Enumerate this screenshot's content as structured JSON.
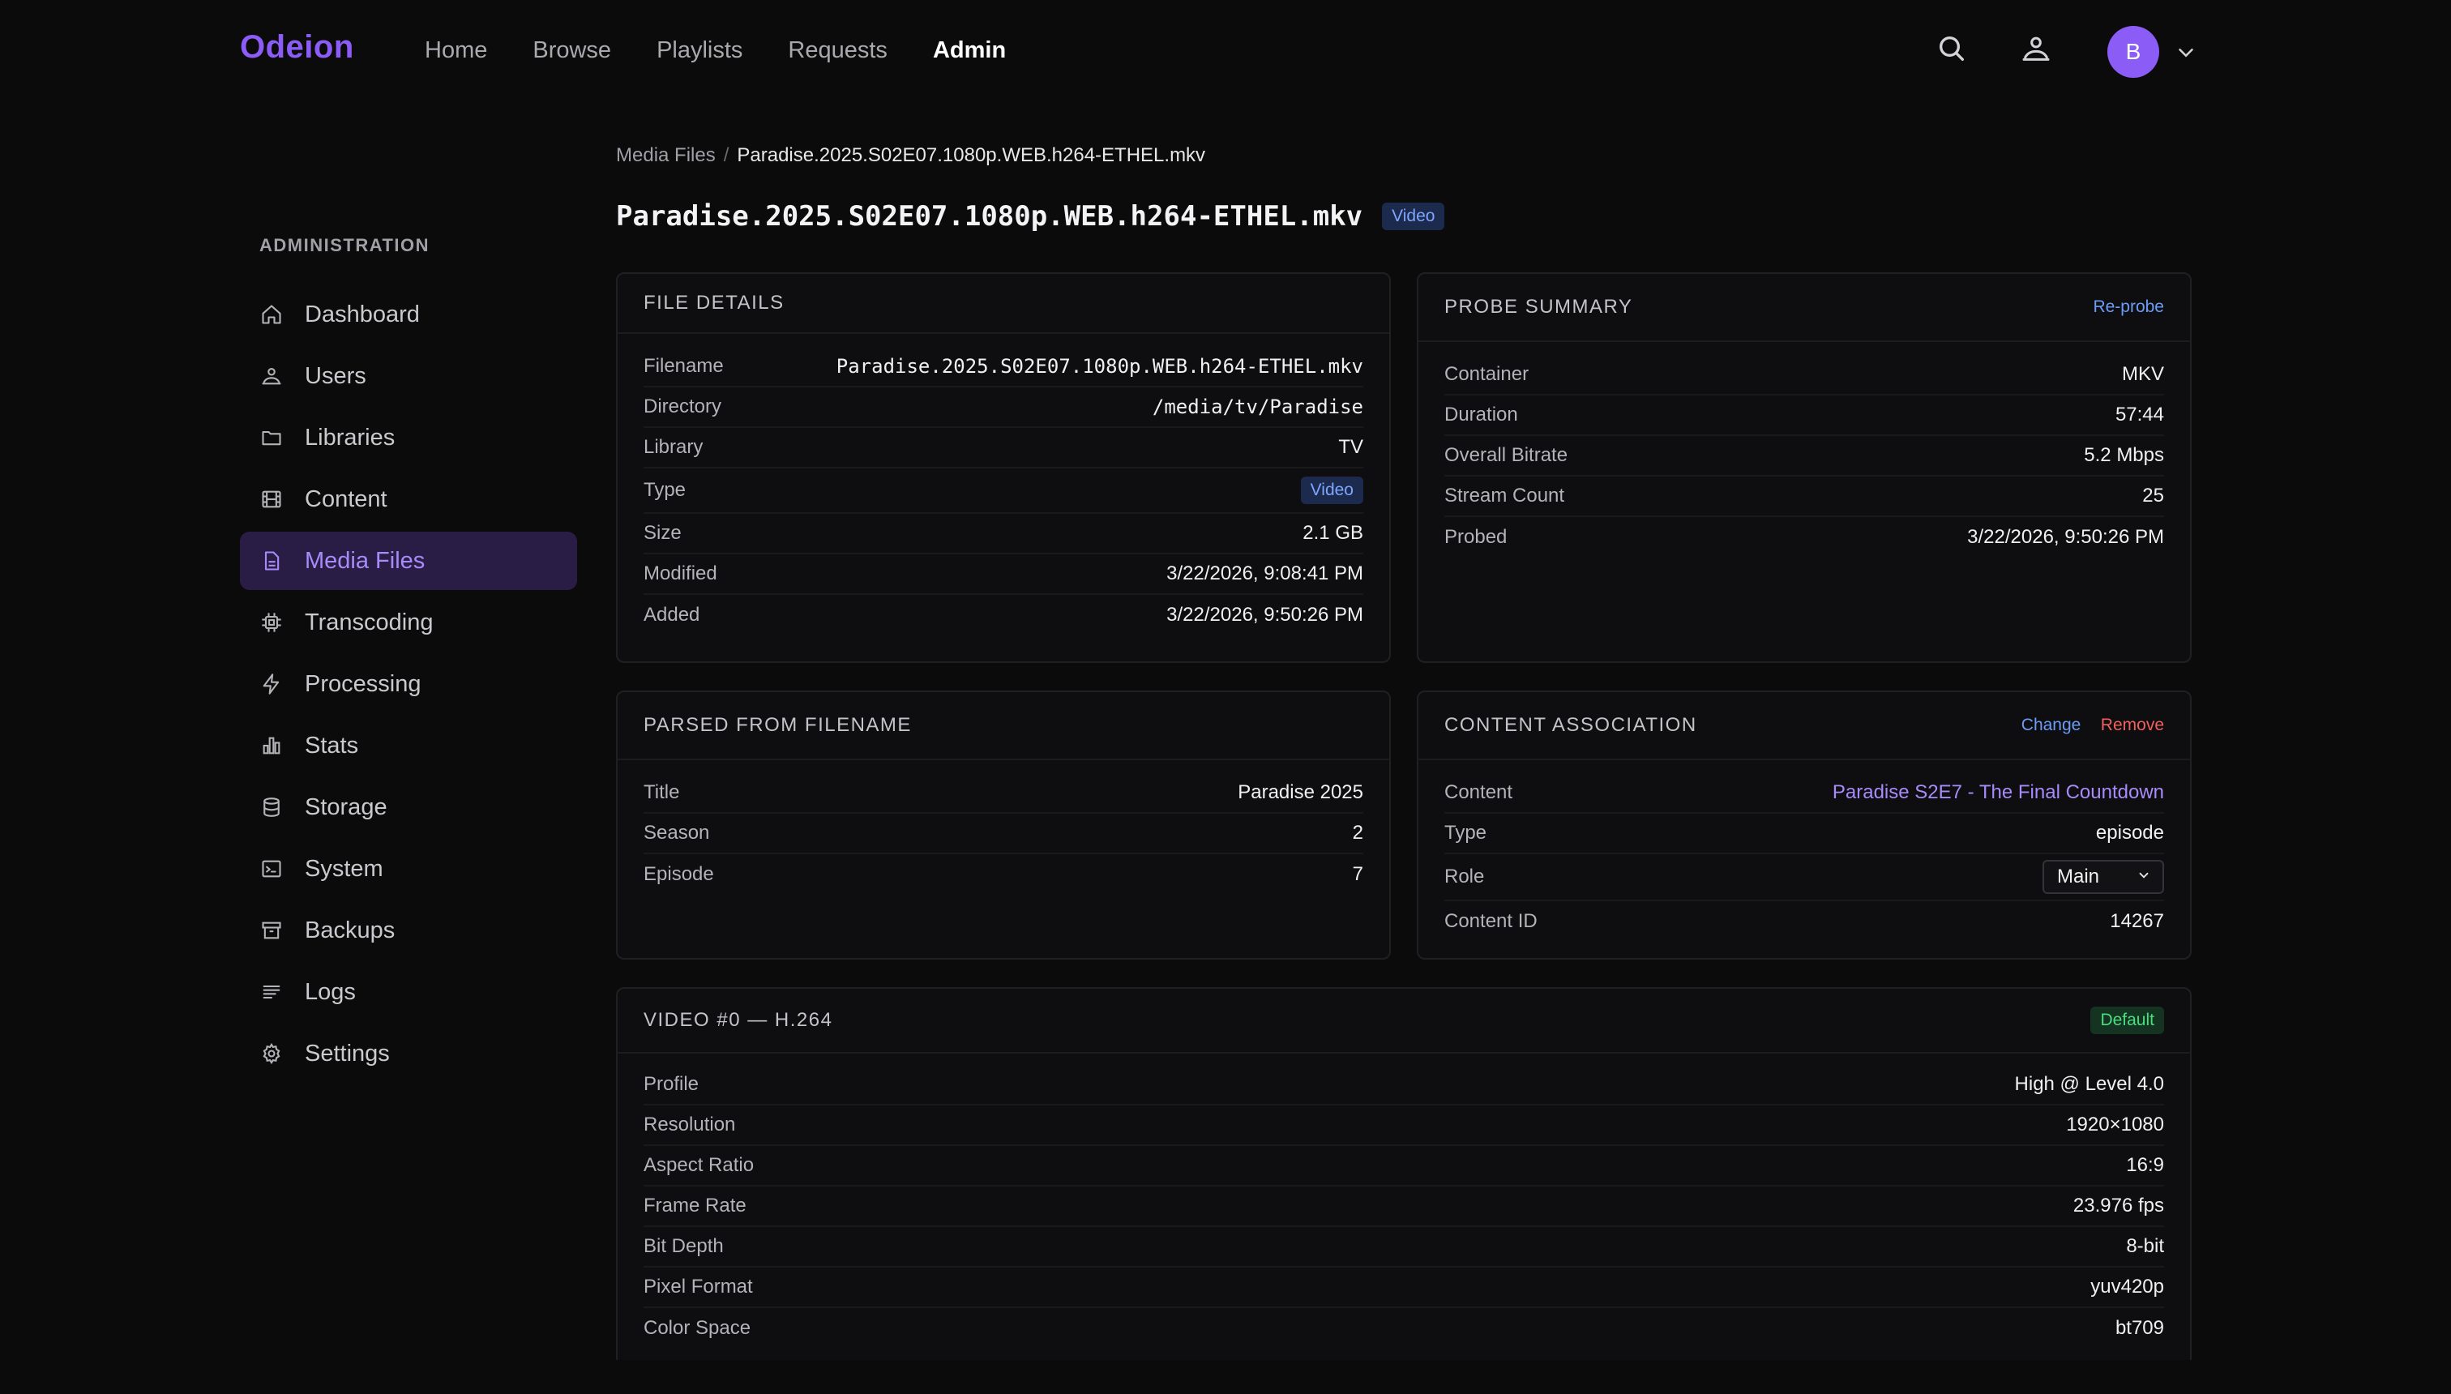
{
  "app": {
    "logo": "Odeion"
  },
  "nav": {
    "items": [
      {
        "label": "Home",
        "active": false
      },
      {
        "label": "Browse",
        "active": false
      },
      {
        "label": "Playlists",
        "active": false
      },
      {
        "label": "Requests",
        "active": false
      },
      {
        "label": "Admin",
        "active": true
      }
    ]
  },
  "user": {
    "initial": "B"
  },
  "sidebar": {
    "heading": "ADMINISTRATION",
    "items": [
      {
        "label": "Dashboard",
        "icon": "home-icon"
      },
      {
        "label": "Users",
        "icon": "users-icon"
      },
      {
        "label": "Libraries",
        "icon": "folder-icon"
      },
      {
        "label": "Content",
        "icon": "film-icon"
      },
      {
        "label": "Media Files",
        "icon": "file-icon",
        "active": true
      },
      {
        "label": "Transcoding",
        "icon": "chip-icon"
      },
      {
        "label": "Processing",
        "icon": "bolt-icon"
      },
      {
        "label": "Stats",
        "icon": "bar-chart-icon"
      },
      {
        "label": "Storage",
        "icon": "database-icon"
      },
      {
        "label": "System",
        "icon": "terminal-icon"
      },
      {
        "label": "Backups",
        "icon": "archive-icon"
      },
      {
        "label": "Logs",
        "icon": "list-icon"
      },
      {
        "label": "Settings",
        "icon": "gear-icon"
      }
    ]
  },
  "breadcrumb": {
    "root": "Media Files",
    "sep": "/",
    "current": "Paradise.2025.S02E07.1080p.WEB.h264-ETHEL.mkv"
  },
  "page": {
    "title": "Paradise.2025.S02E07.1080p.WEB.h264-ETHEL.mkv",
    "badge": "Video"
  },
  "file_details": {
    "title": "FILE DETAILS",
    "rows": [
      {
        "k": "Filename",
        "v": "Paradise.2025.S02E07.1080p.WEB.h264-ETHEL.mkv"
      },
      {
        "k": "Directory",
        "v": "/media/tv/Paradise"
      },
      {
        "k": "Library",
        "v": "TV"
      },
      {
        "k": "Type",
        "v": "Video"
      },
      {
        "k": "Size",
        "v": "2.1 GB"
      },
      {
        "k": "Modified",
        "v": "3/22/2026, 9:08:41 PM"
      },
      {
        "k": "Added",
        "v": "3/22/2026, 9:50:26 PM"
      }
    ]
  },
  "probe_summary": {
    "title": "PROBE SUMMARY",
    "action": "Re-probe",
    "rows": [
      {
        "k": "Container",
        "v": "MKV"
      },
      {
        "k": "Duration",
        "v": "57:44"
      },
      {
        "k": "Overall Bitrate",
        "v": "5.2 Mbps"
      },
      {
        "k": "Stream Count",
        "v": "25"
      },
      {
        "k": "Probed",
        "v": "3/22/2026, 9:50:26 PM"
      }
    ]
  },
  "parsed": {
    "title": "PARSED FROM FILENAME",
    "rows": [
      {
        "k": "Title",
        "v": "Paradise 2025"
      },
      {
        "k": "Season",
        "v": "2"
      },
      {
        "k": "Episode",
        "v": "7"
      }
    ]
  },
  "association": {
    "title": "CONTENT ASSOCIATION",
    "change": "Change",
    "remove": "Remove",
    "content_label": "Content",
    "content_value": "Paradise S2E7 - The Final Countdown",
    "type_label": "Type",
    "type_value": "episode",
    "role_label": "Role",
    "role_value": "Main",
    "id_label": "Content ID",
    "id_value": "14267"
  },
  "video": {
    "title": "VIDEO #0 — H.264",
    "badge": "Default",
    "rows": [
      {
        "k": "Profile",
        "v": "High @ Level 4.0"
      },
      {
        "k": "Resolution",
        "v": "1920×1080"
      },
      {
        "k": "Aspect Ratio",
        "v": "16:9"
      },
      {
        "k": "Frame Rate",
        "v": "23.976 fps"
      },
      {
        "k": "Bit Depth",
        "v": "8-bit"
      },
      {
        "k": "Pixel Format",
        "v": "yuv420p"
      },
      {
        "k": "Color Space",
        "v": "bt709"
      }
    ]
  }
}
